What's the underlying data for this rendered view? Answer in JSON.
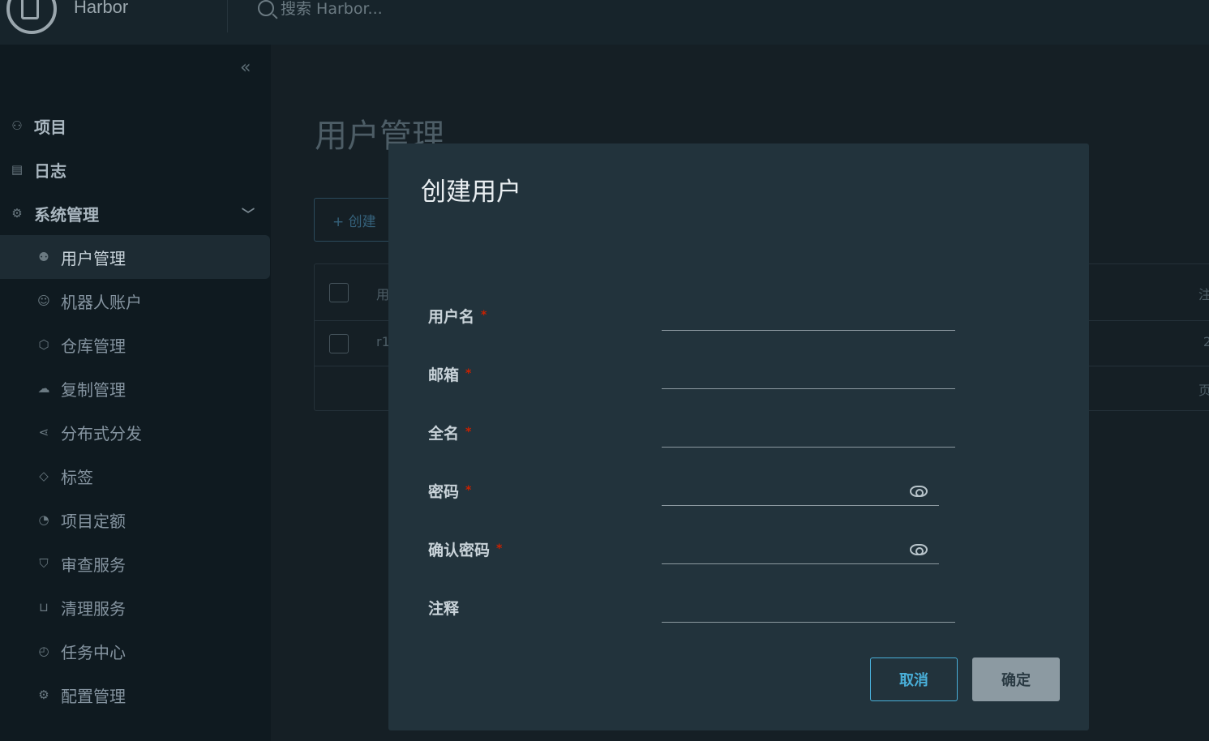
{
  "header": {
    "app_name": "Harbor",
    "search_placeholder": "搜索 Harbor..."
  },
  "sidebar": {
    "collapse_icon": "double-chevron-left-icon",
    "items": [
      {
        "label": "项目",
        "icon": "projects-icon"
      },
      {
        "label": "日志",
        "icon": "logs-icon"
      },
      {
        "label": "系统管理",
        "icon": "admin-icon"
      },
      {
        "label": "用户管理",
        "icon": "users-icon"
      },
      {
        "label": "机器人账户",
        "icon": "robot-icon"
      },
      {
        "label": "仓库管理",
        "icon": "registry-icon"
      },
      {
        "label": "复制管理",
        "icon": "replication-icon"
      },
      {
        "label": "分布式分发",
        "icon": "distribution-icon"
      },
      {
        "label": "标签",
        "icon": "tag-icon"
      },
      {
        "label": "项目定额",
        "icon": "quota-icon"
      },
      {
        "label": "审查服务",
        "icon": "shield-icon"
      },
      {
        "label": "清理服务",
        "icon": "trash-icon"
      },
      {
        "label": "任务中心",
        "icon": "dashboard-icon"
      },
      {
        "label": "配置管理",
        "icon": "gear-icon"
      }
    ]
  },
  "main": {
    "page_title": "用户管理",
    "create_label": "+ 创建",
    "grid_head_partial": "用",
    "grid_row_partial": "r1",
    "grid_right_head": "注",
    "grid_right_row": "2",
    "grid_footer": "页"
  },
  "modal": {
    "title": "创建用户",
    "required_mark": "*",
    "fields": {
      "username": "用户名",
      "email": "邮箱",
      "fullname": "全名",
      "password": "密码",
      "confirm_password": "确认密码",
      "comment": "注释"
    },
    "cancel_label": "取消",
    "ok_label": "确定"
  }
}
